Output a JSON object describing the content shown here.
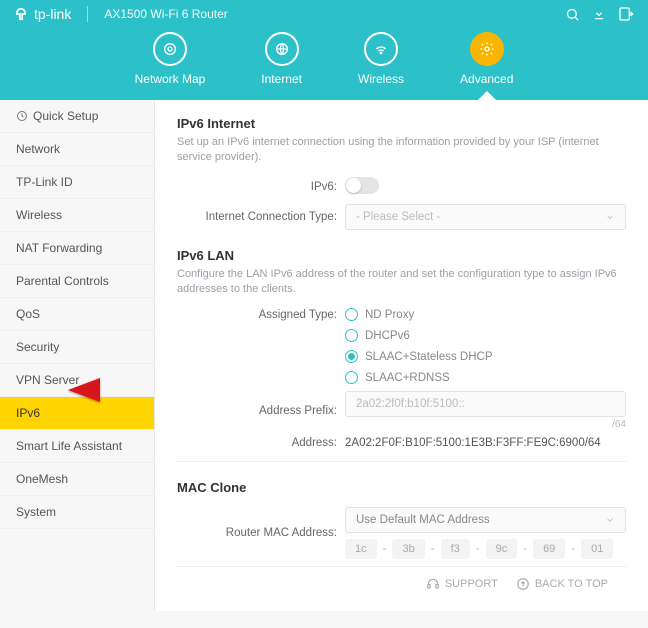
{
  "header": {
    "brand": "tp-link",
    "product": "AX1500 Wi-Fi 6 Router",
    "nav": [
      {
        "label": "Network Map"
      },
      {
        "label": "Internet"
      },
      {
        "label": "Wireless"
      },
      {
        "label": "Advanced"
      }
    ],
    "active_nav": 3
  },
  "sidebar": {
    "items": [
      "Quick Setup",
      "Network",
      "TP-Link ID",
      "Wireless",
      "NAT Forwarding",
      "Parental Controls",
      "QoS",
      "Security",
      "VPN Server",
      "IPv6",
      "Smart Life Assistant",
      "OneMesh",
      "System"
    ],
    "active_index": 9
  },
  "ipv6_internet": {
    "title": "IPv6 Internet",
    "desc": "Set up an IPv6 internet connection using the information provided by your ISP (internet service provider).",
    "toggle_label": "IPv6:",
    "toggle_on": false,
    "conn_type_label": "Internet Connection Type:",
    "conn_type_placeholder": "- Please Select -"
  },
  "ipv6_lan": {
    "title": "IPv6 LAN",
    "desc": "Configure the LAN IPv6 address of the router and set the configuration type to assign IPv6 addresses to the clients.",
    "assigned_label": "Assigned Type:",
    "options": [
      "ND Proxy",
      "DHCPv6",
      "SLAAC+Stateless DHCP",
      "SLAAC+RDNSS"
    ],
    "selected_index": 2,
    "prefix_label": "Address Prefix:",
    "prefix_value": "2a02:2f0f:b10f:5100::",
    "prefix_suffix": "/64",
    "address_label": "Address:",
    "address_value": "2A02:2F0F:B10F:5100:1E3B:F3FF:FE9C:6900/64"
  },
  "mac_clone": {
    "title": "MAC Clone",
    "mac_label": "Router MAC Address:",
    "mac_select": "Use Default MAC Address",
    "mac_segments": [
      "1c",
      "3b",
      "f3",
      "9c",
      "69",
      "01"
    ]
  },
  "footer": {
    "support": "SUPPORT",
    "back_to_top": "BACK TO TOP"
  }
}
